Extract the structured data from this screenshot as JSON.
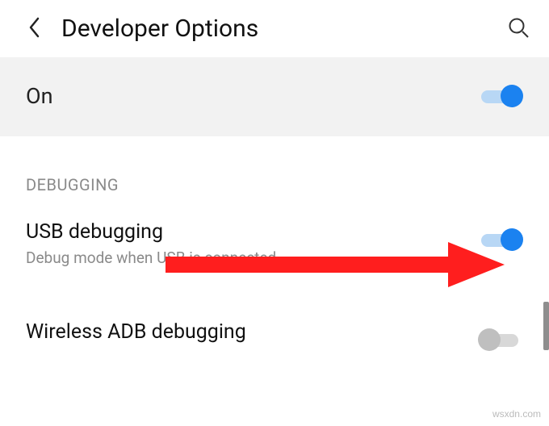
{
  "header": {
    "title": "Developer Options"
  },
  "master": {
    "label": "On",
    "state": "on"
  },
  "section": {
    "debugging_header": "DEBUGGING",
    "usb_debugging": {
      "title": "USB debugging",
      "subtitle": "Debug mode when USB is connected",
      "state": "on"
    },
    "wireless_adb": {
      "title": "Wireless ADB debugging",
      "state": "off"
    }
  },
  "annotation": {
    "arrow_color": "#ff1e1e"
  },
  "watermark": "wsxdn.com"
}
